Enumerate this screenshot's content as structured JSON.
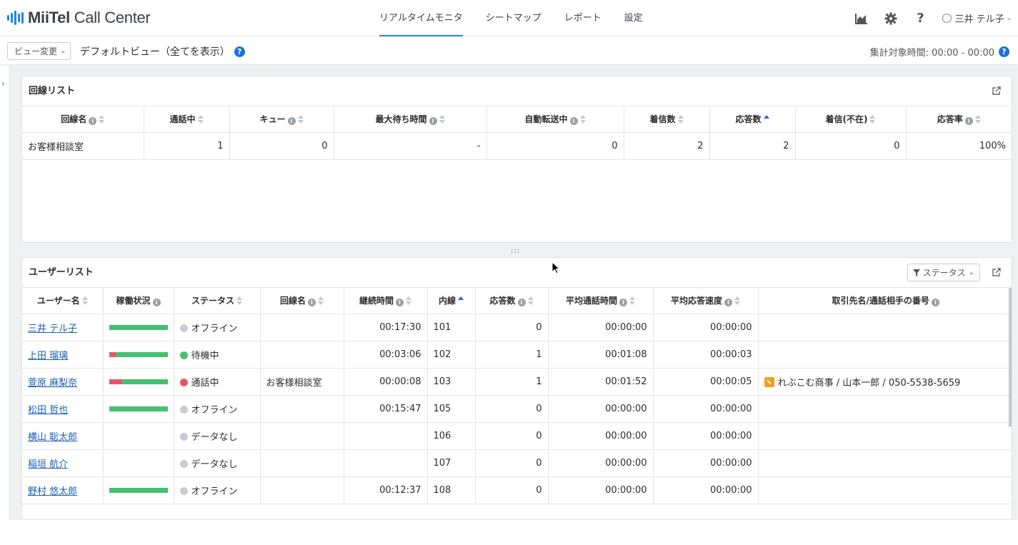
{
  "app": {
    "logo_bold": "MiiTel",
    "logo_text": "Call Center",
    "brand_color": "#1a8bd8"
  },
  "nav": {
    "tabs": [
      {
        "label": "リアルタイムモニタ",
        "active": true
      },
      {
        "label": "シートマップ",
        "active": false
      },
      {
        "label": "レポート",
        "active": false
      },
      {
        "label": "設定",
        "active": false
      }
    ]
  },
  "header": {
    "icons": [
      "chart-icon",
      "gear-icon",
      "help-icon"
    ],
    "user_name": "三井 テル子",
    "help_glyph": "?"
  },
  "subbar": {
    "view_button": "ビュー変更",
    "view_name": "デフォルトビュー（全てを表示）",
    "period": "集計対象時間: 00:00 - 00:00",
    "help_glyph": "?"
  },
  "line_list": {
    "title": "回線リスト",
    "columns": [
      "回線名",
      "通話中",
      "キュー",
      "最大待ち時間",
      "自動転送中",
      "着信数",
      "応答数",
      "着信(不在)",
      "応答率"
    ],
    "rows": [
      [
        "お客様相談室",
        "1",
        "0",
        "-",
        "0",
        "2",
        "2",
        "0",
        "100%"
      ]
    ]
  },
  "user_list": {
    "title": "ユーザーリスト",
    "filter_label": "ステータス",
    "columns": [
      "ユーザー名",
      "稼働状況",
      "ステータス",
      "回線名",
      "継続時間",
      "内線",
      "応答数",
      "平均通話時間",
      "平均応答速度",
      "取引先名/通話相手の番号"
    ],
    "rows": [
      {
        "name": "三井 テル子",
        "busy_ratio": 0,
        "has_bar": true,
        "status": "オフライン",
        "status_color": "#c8ccd2",
        "line": "",
        "duration": "00:17:30",
        "ext": "101",
        "answers": "0",
        "avg_talk": "00:00:00",
        "avg_answer": "00:00:00",
        "partner": ""
      },
      {
        "name": "上田 瑠璃",
        "busy_ratio": 0.12,
        "has_bar": true,
        "status": "待機中",
        "status_color": "#45c06f",
        "line": "",
        "duration": "00:03:06",
        "ext": "102",
        "answers": "1",
        "avg_talk": "00:01:08",
        "avg_answer": "00:00:03",
        "partner": ""
      },
      {
        "name": "萱原 麻梨奈",
        "busy_ratio": 0.22,
        "has_bar": true,
        "status": "通話中",
        "status_color": "#eb5468",
        "line": "お客様相談室",
        "duration": "00:00:08",
        "ext": "103",
        "answers": "1",
        "avg_talk": "00:01:52",
        "avg_answer": "00:00:05",
        "partner": "れぶこむ商事 / 山本一郎 / 050-5538-5659"
      },
      {
        "name": "松田 哲也",
        "busy_ratio": 0,
        "has_bar": true,
        "status": "オフライン",
        "status_color": "#c8ccd2",
        "line": "",
        "duration": "00:15:47",
        "ext": "105",
        "answers": "0",
        "avg_talk": "00:00:00",
        "avg_answer": "00:00:00",
        "partner": ""
      },
      {
        "name": "横山 聡太郎",
        "busy_ratio": 0,
        "has_bar": false,
        "status": "データなし",
        "status_color": "#c8ccd2",
        "line": "",
        "duration": "",
        "ext": "106",
        "answers": "0",
        "avg_talk": "00:00:00",
        "avg_answer": "00:00:00",
        "partner": ""
      },
      {
        "name": "稲垣 航介",
        "busy_ratio": 0,
        "has_bar": false,
        "status": "データなし",
        "status_color": "#c8ccd2",
        "line": "",
        "duration": "",
        "ext": "107",
        "answers": "0",
        "avg_talk": "00:00:00",
        "avg_answer": "00:00:00",
        "partner": ""
      },
      {
        "name": "野村 悠太郎",
        "busy_ratio": 0,
        "has_bar": true,
        "status": "オフライン",
        "status_color": "#c8ccd2",
        "line": "",
        "duration": "00:12:37",
        "ext": "108",
        "answers": "0",
        "avg_talk": "00:00:00",
        "avg_answer": "00:00:00",
        "partner": ""
      }
    ]
  }
}
